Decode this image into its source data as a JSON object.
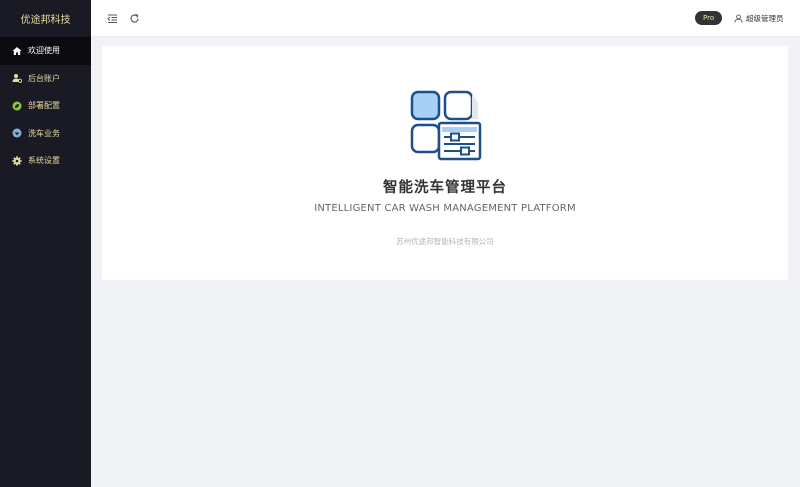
{
  "sidebar": {
    "brand": "优途邦科技",
    "items": [
      {
        "label": "欢迎使用",
        "icon": "home-icon",
        "active": true
      },
      {
        "label": "后台账户",
        "icon": "user-gear-icon",
        "active": false
      },
      {
        "label": "部署配置",
        "icon": "deploy-icon",
        "active": false
      },
      {
        "label": "洗车业务",
        "icon": "car-wash-icon",
        "active": false
      },
      {
        "label": "系统设置",
        "icon": "gear-icon",
        "active": false
      }
    ]
  },
  "header": {
    "menu_toggle_icon": "menu-fold-icon",
    "refresh_icon": "refresh-icon",
    "badge": "Pro",
    "user_icon": "user-icon",
    "user_name": "超级管理员"
  },
  "main": {
    "logo_icon": "platform-logo-icon",
    "title": "智能洗车管理平台",
    "subtitle": "INTELLIGENT CAR WASH MANAGEMENT PLATFORM",
    "company": "苏州优途邦智能科技有限公司"
  },
  "colors": {
    "sidebar_bg": "#191a23",
    "sidebar_active_bg": "#0a0a0f",
    "sidebar_text": "#e8d9a0",
    "logo_dark": "#1d4f88",
    "logo_light": "#a6d0f5",
    "page_bg": "#f0f2f5"
  }
}
